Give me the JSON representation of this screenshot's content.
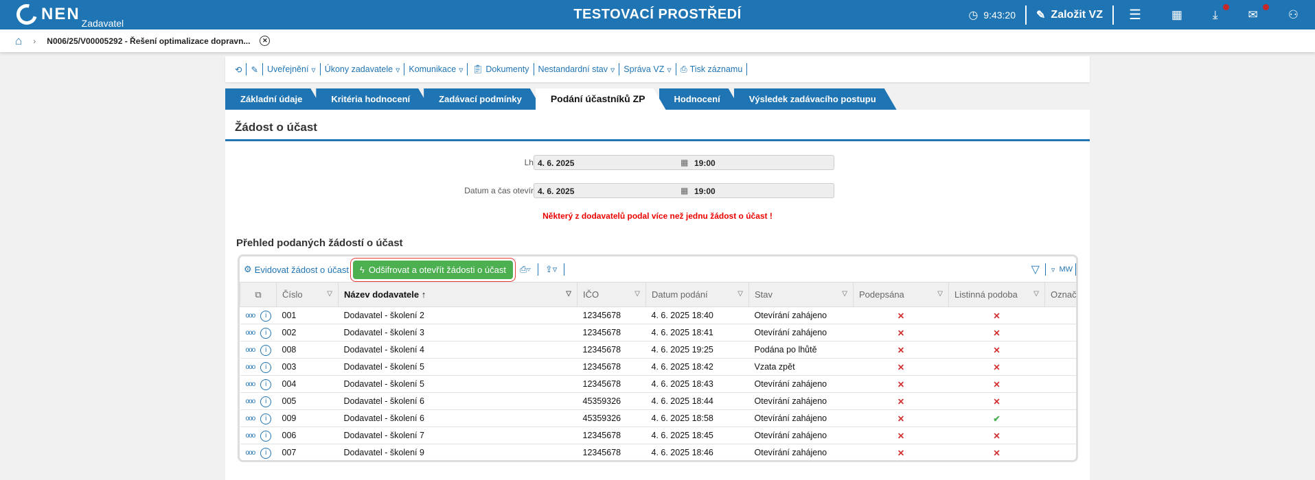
{
  "header": {
    "logo": "NEN",
    "logo_sub": "Zadavatel",
    "title": "TESTOVACÍ PROSTŘEDÍ",
    "time": "9:43:20",
    "create_label": "Založit VZ"
  },
  "breadcrumb": {
    "item": "N006/25/V00005292 - Řešení optimalizace dopravn..."
  },
  "toolbar": {
    "items": [
      "Uveřejnění",
      "Úkony zadavatele",
      "Komunikace",
      "Dokumenty",
      "Nestandardní stav",
      "Správa VZ",
      "Tisk záznamu"
    ]
  },
  "tabs": [
    "Základní údaje",
    "Kritéria hodnocení",
    "Zadávací podmínky",
    "Podání účastníků ZP",
    "Hodnocení",
    "Výsledek zadávacího postupu"
  ],
  "panel": {
    "title": "Žádost o účast",
    "deadline": {
      "label": "Lhůta:",
      "date": "4. 6. 2025",
      "time": "19:00"
    },
    "opening": {
      "label": "Datum a čas otevírání:",
      "date": "4. 6. 2025",
      "time": "19:00"
    },
    "warning": "Některý z dodavatelů podal více než jednu žádost o účast !",
    "section_title": "Přehled podaných žádostí o účast"
  },
  "grid": {
    "register_label": "Evidovat žádost o účast",
    "decrypt_label": "Odšifrovat a otevřít žádosti o účast",
    "user": "MW",
    "columns": [
      "Číslo",
      "Název dodavatele",
      "IČO",
      "Datum podání",
      "Stav",
      "Podepsána",
      "Listinná podoba",
      "Označ"
    ],
    "rows": [
      [
        "001",
        "Dodavatel - školení 2",
        "12345678",
        "4. 6. 2025 18:40",
        "Otevírání zahájeno",
        false,
        false
      ],
      [
        "002",
        "Dodavatel - školení 3",
        "12345678",
        "4. 6. 2025 18:41",
        "Otevírání zahájeno",
        false,
        false
      ],
      [
        "008",
        "Dodavatel - školení 4",
        "12345678",
        "4. 6. 2025 19:25",
        "Podána po lhůtě",
        false,
        false
      ],
      [
        "003",
        "Dodavatel - školení 5",
        "12345678",
        "4. 6. 2025 18:42",
        "Vzata zpět",
        false,
        false
      ],
      [
        "004",
        "Dodavatel - školení 5",
        "12345678",
        "4. 6. 2025 18:43",
        "Otevírání zahájeno",
        false,
        false
      ],
      [
        "005",
        "Dodavatel - školení 6",
        "45359326",
        "4. 6. 2025 18:44",
        "Otevírání zahájeno",
        false,
        false
      ],
      [
        "009",
        "Dodavatel - školení 6",
        "45359326",
        "4. 6. 2025 18:58",
        "Otevírání zahájeno",
        false,
        true
      ],
      [
        "006",
        "Dodavatel - školení 7",
        "12345678",
        "4. 6. 2025 18:45",
        "Otevírání zahájeno",
        false,
        false
      ],
      [
        "007",
        "Dodavatel - školení 9",
        "12345678",
        "4. 6. 2025 18:46",
        "Otevírání zahájeno",
        false,
        false
      ]
    ]
  }
}
